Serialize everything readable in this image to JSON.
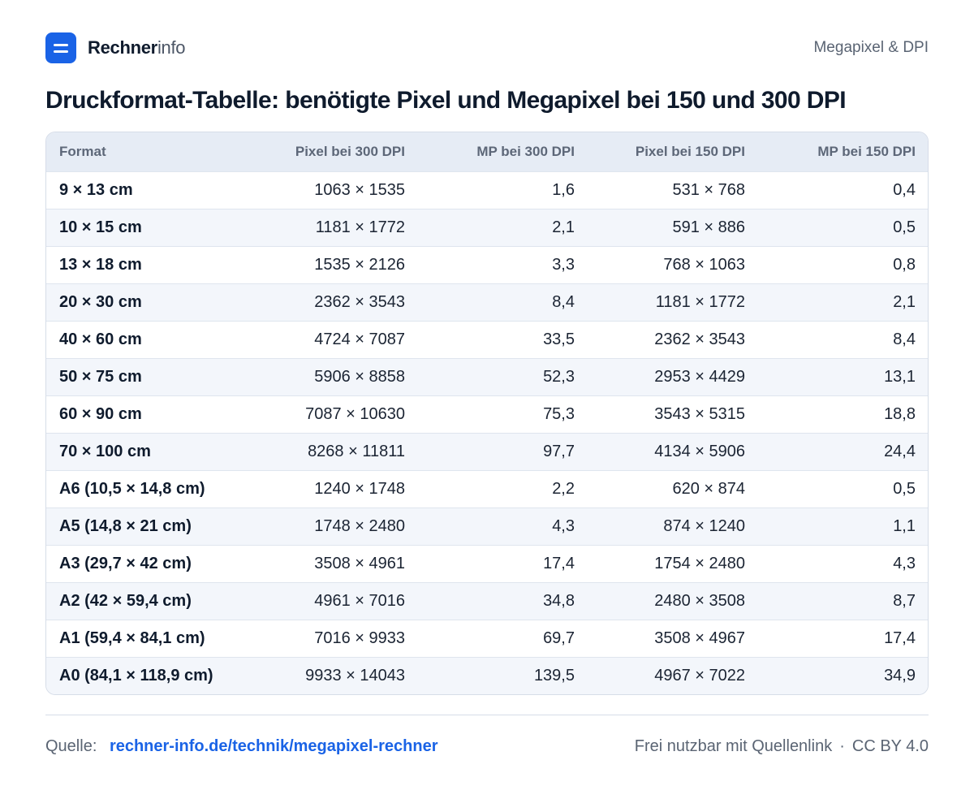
{
  "header": {
    "brand_bold": "Rechner",
    "brand_light": "info",
    "top_right": "Megapixel & DPI",
    "logo_icon": "equals-logo-icon",
    "accent_color": "#1a63e6"
  },
  "title": "Druckformat-Tabelle: benötigte Pixel und Megapixel bei 150 und 300 DPI",
  "table": {
    "columns": [
      "Format",
      "Pixel bei 300 DPI",
      "MP bei 300 DPI",
      "Pixel bei 150 DPI",
      "MP bei 150 DPI"
    ],
    "rows": [
      [
        "9 × 13 cm",
        "1063 × 1535",
        "1,6",
        "531 × 768",
        "0,4"
      ],
      [
        "10 × 15 cm",
        "1181 × 1772",
        "2,1",
        "591 × 886",
        "0,5"
      ],
      [
        "13 × 18 cm",
        "1535 × 2126",
        "3,3",
        "768 × 1063",
        "0,8"
      ],
      [
        "20 × 30 cm",
        "2362 × 3543",
        "8,4",
        "1181 × 1772",
        "2,1"
      ],
      [
        "40 × 60 cm",
        "4724 × 7087",
        "33,5",
        "2362 × 3543",
        "8,4"
      ],
      [
        "50 × 75 cm",
        "5906 × 8858",
        "52,3",
        "2953 × 4429",
        "13,1"
      ],
      [
        "60 × 90 cm",
        "7087 × 10630",
        "75,3",
        "3543 × 5315",
        "18,8"
      ],
      [
        "70 × 100 cm",
        "8268 × 11811",
        "97,7",
        "4134 × 5906",
        "24,4"
      ],
      [
        "A6 (10,5 × 14,8 cm)",
        "1240 × 1748",
        "2,2",
        "620 × 874",
        "0,5"
      ],
      [
        "A5 (14,8 × 21 cm)",
        "1748 × 2480",
        "4,3",
        "874 × 1240",
        "1,1"
      ],
      [
        "A3 (29,7 × 42 cm)",
        "3508 × 4961",
        "17,4",
        "1754 × 2480",
        "4,3"
      ],
      [
        "A2 (42 × 59,4 cm)",
        "4961 × 7016",
        "34,8",
        "2480 × 3508",
        "8,7"
      ],
      [
        "A1 (59,4 × 84,1 cm)",
        "7016 × 9933",
        "69,7",
        "3508 × 4967",
        "17,4"
      ],
      [
        "A0 (84,1 × 118,9 cm)",
        "9933 × 14043",
        "139,5",
        "4967 × 7022",
        "34,9"
      ]
    ]
  },
  "footer": {
    "source_label": "Quelle:",
    "source_link": "rechner-info.de/technik/megapixel-rechner",
    "license_text": "Frei nutzbar mit Quellenlink",
    "separator": "·",
    "license_name": "CC BY 4.0"
  }
}
